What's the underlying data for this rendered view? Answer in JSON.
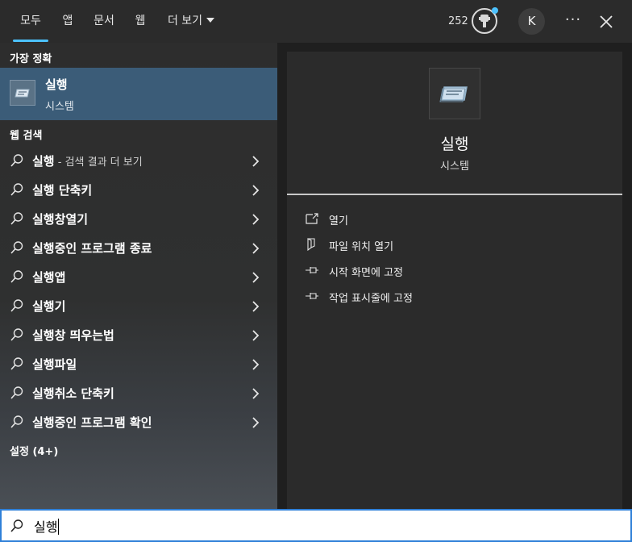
{
  "tabs": [
    {
      "label": "모두",
      "active": true
    },
    {
      "label": "앱"
    },
    {
      "label": "문서"
    },
    {
      "label": "웹"
    },
    {
      "label": "더 보기"
    }
  ],
  "header": {
    "points": "252",
    "avatar_initial": "K",
    "more_icon": "more-icon",
    "close_icon": "close-icon"
  },
  "left": {
    "best_match_heading": "가장 정확",
    "best_match": {
      "title": "실행",
      "subtitle": "시스템",
      "icon": "run-app-icon"
    },
    "web_heading": "웹 검색",
    "web_items": [
      {
        "bold": "실행",
        "rest": "",
        "hint": " - 검색 결과 더 보기"
      },
      {
        "bold": "실행",
        "rest": " 단축키",
        "hint": ""
      },
      {
        "bold": "실행",
        "rest": "창열기",
        "hint": ""
      },
      {
        "bold": "실행",
        "rest": "중인 프로그램 종료",
        "hint": ""
      },
      {
        "bold": "실행",
        "rest": "앱",
        "hint": ""
      },
      {
        "bold": "실행",
        "rest": "기",
        "hint": ""
      },
      {
        "bold": "실행",
        "rest": "창 띄우는법",
        "hint": ""
      },
      {
        "bold": "실행",
        "rest": "파일",
        "hint": ""
      },
      {
        "bold": "실행",
        "rest": "취소 단축키",
        "hint": ""
      },
      {
        "bold": "실행",
        "rest": "중인 프로그램 확인",
        "hint": ""
      }
    ],
    "settings_heading": "설정 (4+)"
  },
  "right": {
    "title": "실행",
    "subtitle": "시스템",
    "actions": [
      {
        "label": "열기",
        "icon": "open-icon"
      },
      {
        "label": "파일 위치 열기",
        "icon": "file-location-icon"
      },
      {
        "label": "시작 화면에 고정",
        "icon": "pin-icon"
      },
      {
        "label": "작업 표시줄에 고정",
        "icon": "pin-icon"
      }
    ]
  },
  "search": {
    "value": "실행"
  },
  "colors": {
    "accent": "#4cc2ff",
    "selected_bg": "#3b5c78",
    "search_border": "#2f80d8"
  }
}
